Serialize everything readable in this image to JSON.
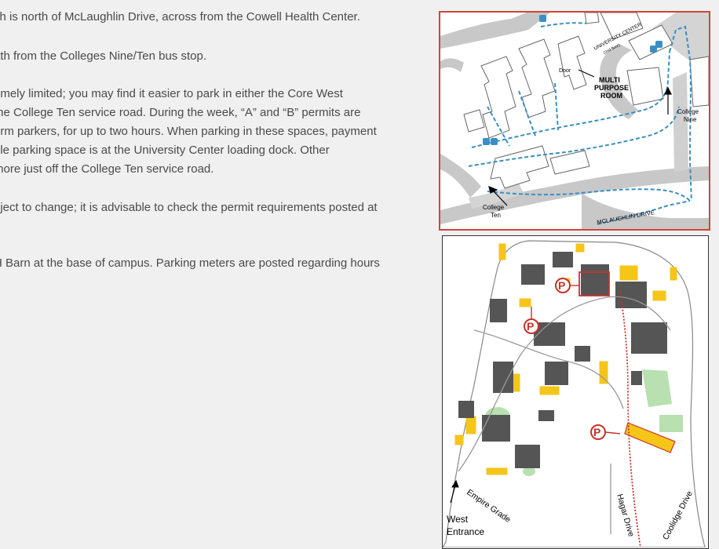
{
  "article": {
    "paragraphs": [
      "ch is north of McLaughlin Drive, across from the Cowell Health Center.",
      "ath from the Colleges Nine/Ten bus stop.",
      "emely limited; you may find it easier to park in either the Core West",
      " the College Ten service road. During the week, “A” and “B” permits are",
      "erm parkers, for up to two hours. When parking in these spaces, payment",
      "ble parking space is at the University Center loading dock. Other",
      " more just off the College Ten service road.",
      "bject to change; it is advisable to check the permit requirements posted at",
      "H Barn at the base of campus. Parking meters are posted regarding hours"
    ]
  },
  "detail_map": {
    "university_center": "UNIVERSITY CENTER",
    "university_center_floor": "(2nd floor)",
    "door": "Door",
    "room_line1": "MULTI",
    "room_line2": "PURPOSE",
    "room_line3": "ROOM",
    "college_nine_line1": "College",
    "college_nine_line2": "Nine",
    "college_ten_line1": "College",
    "college_ten_line2": "Ten",
    "road": "MCLAUGHLIN DRIVE",
    "accessible_icon": "accessible-icon",
    "colors": {
      "frame": "#d0453a",
      "path": "#3a8fc2",
      "building": "#cfcfcf",
      "road": "#c8c8c8"
    }
  },
  "campus_map": {
    "parking_symbol": "P",
    "west_entrance_line1": "West",
    "west_entrance_line2": "Entrance",
    "empire_grade": "Empire Grade",
    "hagar_drive": "Hagar Drive",
    "coolidge_drive": "Coolidge Drive",
    "colors": {
      "parking": "#c8322b",
      "lots": "#f5c518",
      "fields": "#b8e0b0"
    }
  }
}
